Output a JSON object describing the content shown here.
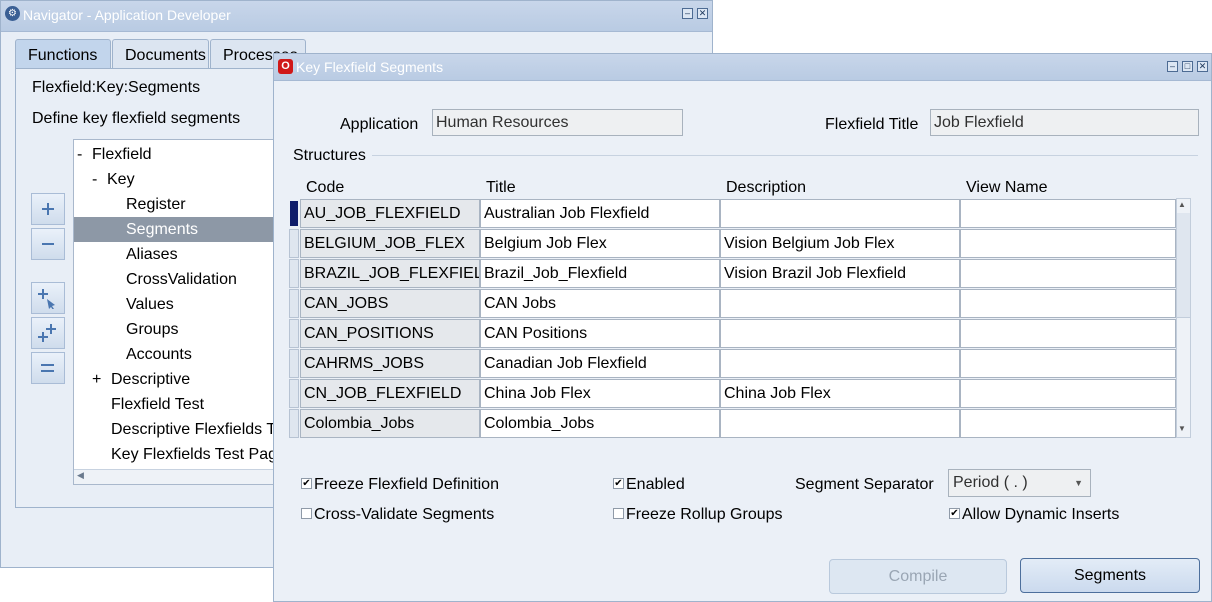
{
  "navigator": {
    "title": "Navigator - Application Developer",
    "tabs": [
      "Functions",
      "Documents",
      "Processes"
    ],
    "function_path": "Flexfield:Key:Segments",
    "function_desc": "Define key flexfield segments",
    "tree": [
      {
        "prefix": "-",
        "label": "Flexfield"
      },
      {
        "prefix": "-",
        "label": "Key"
      },
      {
        "prefix": "",
        "label": "Register"
      },
      {
        "prefix": "",
        "label": "Segments"
      },
      {
        "prefix": "",
        "label": "Aliases"
      },
      {
        "prefix": "",
        "label": "CrossValidation"
      },
      {
        "prefix": "",
        "label": "Values"
      },
      {
        "prefix": "",
        "label": "Groups"
      },
      {
        "prefix": "",
        "label": "Accounts"
      },
      {
        "prefix": "+",
        "label": "Descriptive"
      },
      {
        "prefix": "",
        "label": "Flexfield Test"
      },
      {
        "prefix": "",
        "label": "Descriptive Flexfields Test Page"
      },
      {
        "prefix": "",
        "label": "Key Flexfields Test Page"
      }
    ],
    "selected_tree_item": "Segments",
    "side_buttons": [
      "plus-icon",
      "minus-icon",
      "expand-branch-icon",
      "expand-all-icon",
      "collapse-all-icon"
    ]
  },
  "kf": {
    "title": "Key Flexfield Segments",
    "application_label": "Application",
    "application_value": "Human Resources",
    "flexfield_title_label": "Flexfield Title",
    "flexfield_title_value": "Job Flexfield",
    "structures_label": "Structures",
    "columns": [
      "Code",
      "Title",
      "Description",
      "View Name"
    ],
    "rows": [
      {
        "code": "AU_JOB_FLEXFIELD",
        "title": "Australian Job Flexfield",
        "description": "",
        "view_name": ""
      },
      {
        "code": "BELGIUM_JOB_FLEX",
        "title": "Belgium Job Flex",
        "description": "Vision Belgium Job Flex",
        "view_name": ""
      },
      {
        "code": "BRAZIL_JOB_FLEXFIELD",
        "title": "Brazil_Job_Flexfield",
        "description": "Vision Brazil Job Flexfield",
        "view_name": ""
      },
      {
        "code": "CAN_JOBS",
        "title": "CAN Jobs",
        "description": "",
        "view_name": ""
      },
      {
        "code": "CAN_POSITIONS",
        "title": "CAN Positions",
        "description": "",
        "view_name": ""
      },
      {
        "code": "CAHRMS_JOBS",
        "title": "Canadian Job Flexfield",
        "description": "",
        "view_name": ""
      },
      {
        "code": "CN_JOB_FLEXFIELD",
        "title": "China Job Flex",
        "description": "China Job Flex",
        "view_name": ""
      },
      {
        "code": "Colombia_Jobs",
        "title": "Colombia_Jobs",
        "description": "",
        "view_name": ""
      }
    ],
    "checkboxes": {
      "freeze_definition": {
        "label": "Freeze Flexfield Definition",
        "checked": true
      },
      "enabled": {
        "label": "Enabled",
        "checked": true
      },
      "cross_validate": {
        "label": "Cross-Validate Segments",
        "checked": false
      },
      "freeze_rollup": {
        "label": "Freeze Rollup Groups",
        "checked": false
      },
      "allow_dynamic": {
        "label": "Allow Dynamic Inserts",
        "checked": true
      }
    },
    "segment_separator_label": "Segment Separator",
    "segment_separator_value": "Period ( . )",
    "buttons": {
      "compile": "Compile",
      "segments": "Segments"
    }
  },
  "colors": {
    "titlebar": "#b9cbe3",
    "selected_row_marker": "#0f1d6b",
    "tree_selection": "#8d98a6",
    "oracle_icon": "#d01818"
  }
}
